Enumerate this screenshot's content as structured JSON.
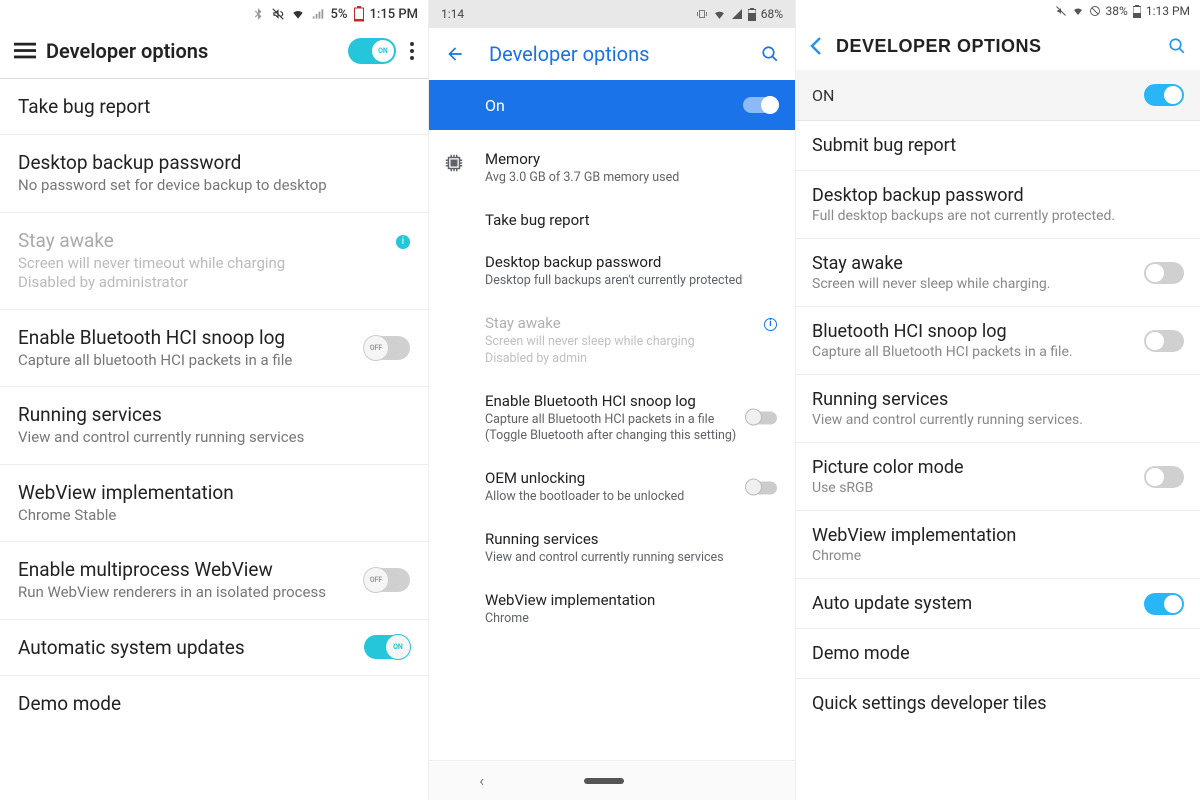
{
  "phone1": {
    "status": {
      "battery": "5%",
      "time": "1:15 PM"
    },
    "title": "Developer options",
    "main_toggle": "ON",
    "rows": {
      "r0": {
        "title": "Take bug report"
      },
      "r1": {
        "title": "Desktop backup password",
        "sub": "No password set for device backup to desktop"
      },
      "r2": {
        "title": "Stay awake",
        "sub": "Screen will never timeout while charging\nDisabled by administrator"
      },
      "r3": {
        "title": "Enable Bluetooth HCI snoop log",
        "sub": "Capture all bluetooth HCI packets in a file",
        "toggle": "OFF"
      },
      "r4": {
        "title": "Running services",
        "sub": "View and control currently running services"
      },
      "r5": {
        "title": "WebView implementation",
        "sub": "Chrome Stable"
      },
      "r6": {
        "title": "Enable multiprocess WebView",
        "sub": "Run WebView renderers in an isolated process",
        "toggle": "OFF"
      },
      "r7": {
        "title": "Automatic system updates",
        "toggle": "ON"
      },
      "r8": {
        "title": "Demo mode"
      }
    }
  },
  "phone2": {
    "status": {
      "time": "1:14",
      "battery": "68%"
    },
    "title": "Developer options",
    "on_label": "On",
    "rows": {
      "r0": {
        "title": "Memory",
        "sub": "Avg 3.0 GB of 3.7 GB memory used"
      },
      "r1": {
        "title": "Take bug report"
      },
      "r2": {
        "title": "Desktop backup password",
        "sub": "Desktop full backups aren't currently protected"
      },
      "r3": {
        "title": "Stay awake",
        "sub": "Screen will never sleep while charging\nDisabled by admin"
      },
      "r4": {
        "title": "Enable Bluetooth HCI snoop log",
        "sub": "Capture all Bluetooth HCI packets in a file (Toggle Bluetooth after changing this setting)"
      },
      "r5": {
        "title": "OEM unlocking",
        "sub": "Allow the bootloader to be unlocked"
      },
      "r6": {
        "title": "Running services",
        "sub": "View and control currently running services"
      },
      "r7": {
        "title": "WebView implementation",
        "sub": "Chrome"
      }
    }
  },
  "phone3": {
    "status": {
      "battery": "38%",
      "time": "1:13 PM"
    },
    "title": "DEVELOPER OPTIONS",
    "on_label": "ON",
    "rows": {
      "r0": {
        "title": "Submit bug report"
      },
      "r1": {
        "title": "Desktop backup password",
        "sub": "Full desktop backups are not currently protected."
      },
      "r2": {
        "title": "Stay awake",
        "sub": "Screen will never sleep while charging."
      },
      "r3": {
        "title": "Bluetooth HCI snoop log",
        "sub": "Capture all Bluetooth HCI packets in a file."
      },
      "r4": {
        "title": "Running services",
        "sub": "View and control currently running services."
      },
      "r5": {
        "title": "Picture color mode",
        "sub": "Use sRGB"
      },
      "r6": {
        "title": "WebView implementation",
        "sub": "Chrome"
      },
      "r7": {
        "title": "Auto update system"
      },
      "r8": {
        "title": "Demo mode"
      },
      "r9": {
        "title": "Quick settings developer tiles"
      }
    }
  }
}
